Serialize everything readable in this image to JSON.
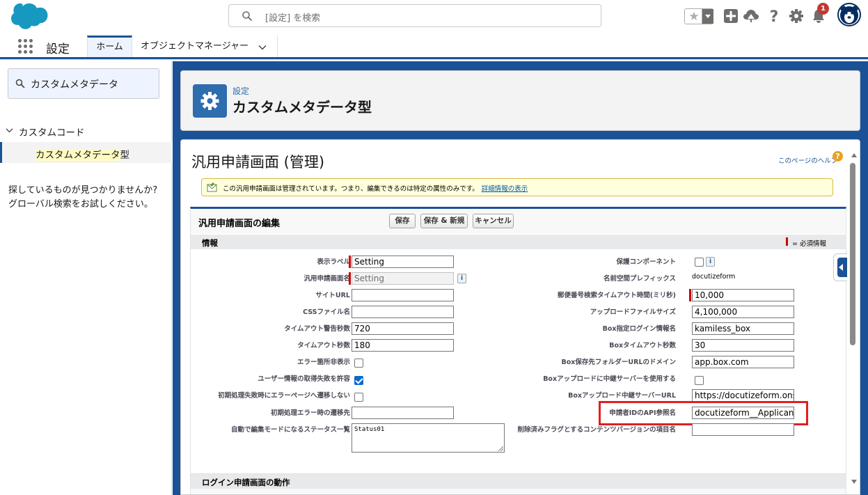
{
  "header": {
    "search_placeholder": "[設定] を検索",
    "notification_count": "1",
    "star_glyph": "★",
    "help_glyph": "?"
  },
  "nav": {
    "app_name": "設定",
    "tabs": [
      {
        "label": "ホーム"
      },
      {
        "label": "オブジェクトマネージャー"
      }
    ]
  },
  "sidebar": {
    "quick_find_value": "カスタムメタデータ",
    "tree_parent": "カスタムコード",
    "tree_child": "カスタムメタデータ型",
    "tree_child_highlight": "カスタムメタデータ",
    "tree_child_suffix": "型",
    "not_found_line1": "探しているものが見つかりませんか?",
    "not_found_line2": "グローバル検索をお試しください。"
  },
  "page_header": {
    "breadcrumb": "設定",
    "title": "カスタムメタデータ型"
  },
  "main": {
    "title": "汎用申請画面 (管理)",
    "help_link": "このページのヘルプ",
    "help_glyph": "?",
    "message": "この汎用申請画面は管理されています。つまり、編集できるのは特定の属性のみです。",
    "message_link": "詳細情報の表示",
    "edit_title": "汎用申請画面の編集",
    "buttons": {
      "save": "保存",
      "save_new": "保存 & 新規",
      "cancel": "キャンセル"
    },
    "section_info": "情報",
    "required_legend": "= 必須情報",
    "section_login": "ログイン申請画面の動作",
    "info_glyph": "i",
    "left_fields": [
      {
        "label": "表示ラベル",
        "value": "Setting"
      },
      {
        "label": "汎用申請画面名",
        "value": "Setting"
      },
      {
        "label": "サイトURL",
        "value": ""
      },
      {
        "label": "CSSファイル名",
        "value": ""
      },
      {
        "label": "タイムアウト警告秒数",
        "value": "720"
      },
      {
        "label": "タイムアウト秒数",
        "value": "180"
      },
      {
        "label": "エラー箇所非表示",
        "checked": false
      },
      {
        "label": "ユーザー情報の取得失敗を許容",
        "checked": true
      },
      {
        "label": "初期処理失敗時にエラーページへ遷移しない",
        "checked": false
      },
      {
        "label": "初期処理エラー時の遷移先",
        "value": ""
      },
      {
        "label": "自動で編集モードになるステータス一覧",
        "value": "Status01"
      }
    ],
    "right_fields": [
      {
        "label": "保護コンポーネント",
        "checked": false
      },
      {
        "label": "名前空間プレフィックス",
        "value": "docutizeform"
      },
      {
        "label": "郵便番号検索タイムアウト時間(ミリ秒)",
        "value": "10,000"
      },
      {
        "label": "アップロードファイルサイズ",
        "value": "4,100,000"
      },
      {
        "label": "Box指定ログイン情報名",
        "value": "kamiless_box"
      },
      {
        "label": "Boxタイムアウト秒数",
        "value": "30"
      },
      {
        "label": "Box保存先フォルダーURLのドメイン",
        "value": "app.box.com"
      },
      {
        "label": "Boxアップロードに中継サーバーを使用する",
        "checked": false
      },
      {
        "label": "Boxアップロード中継サーバーURL",
        "value": "https://docutizeform.ons"
      },
      {
        "label": "申請者IDのAPI参照名",
        "value": "docutizeform__ApplicantId"
      },
      {
        "label": "削除済みフラグとするコンテンツバージョンの項目名",
        "value": ""
      }
    ]
  }
}
